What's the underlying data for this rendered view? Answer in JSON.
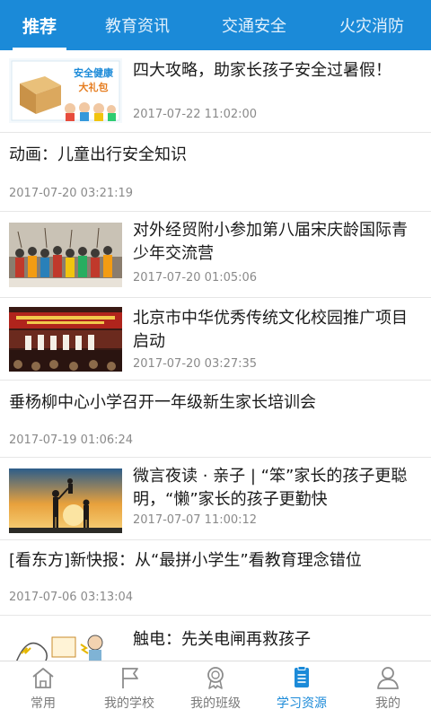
{
  "tabs": [
    {
      "label": "推荐",
      "active": true
    },
    {
      "label": "教育资讯",
      "active": false
    },
    {
      "label": "交通安全",
      "active": false
    },
    {
      "label": "火灾消防",
      "active": false
    }
  ],
  "articles": [
    {
      "title": "四大攻略，助家长孩子安全过暑假！",
      "date": "2017-07-22 11:02:00",
      "thumb": "safety-gift-pack-image",
      "thumb_text": [
        "安全健康",
        "大礼包"
      ]
    },
    {
      "title": "动画：儿童出行安全知识",
      "date": "2017-07-20 03:21:19"
    },
    {
      "title": "对外经贸附小参加第八届宋庆龄国际青少年交流营",
      "date": "2017-07-20 01:05:06",
      "thumb": "student-performance-photo"
    },
    {
      "title": "北京市中华优秀传统文化校园推广项目启动",
      "date": "2017-07-20 03:27:35",
      "thumb": "stage-ceremony-photo"
    },
    {
      "title": "垂杨柳中心小学召开一年级新生家长培训会",
      "date": "2017-07-19 01:06:24"
    },
    {
      "title": "微言夜读 · 亲子 | “笨”家长的孩子更聪明，“懒”家长的孩子更勤快",
      "date": "2017-07-07 11:00:12",
      "thumb": "parent-child-sunset-photo"
    },
    {
      "title": "[看东方]新快报：从“最拼小学生”看教育理念错位",
      "date": "2017-07-06 03:13:04"
    },
    {
      "title": "触电：先关电闸再救孩子",
      "thumb": "electric-shock-cartoon"
    }
  ],
  "nav": [
    {
      "label": "常用",
      "icon": "home-icon",
      "active": false
    },
    {
      "label": "我的学校",
      "icon": "flag-icon",
      "active": false
    },
    {
      "label": "我的班级",
      "icon": "medal-icon",
      "active": false
    },
    {
      "label": "学习资源",
      "icon": "document-icon",
      "active": true
    },
    {
      "label": "我的",
      "icon": "person-icon",
      "active": false
    }
  ],
  "colors": {
    "primary": "#1b8ad8",
    "text": "#1a1a1a",
    "muted": "#8a8a8a",
    "divider": "#e6e6e6"
  }
}
